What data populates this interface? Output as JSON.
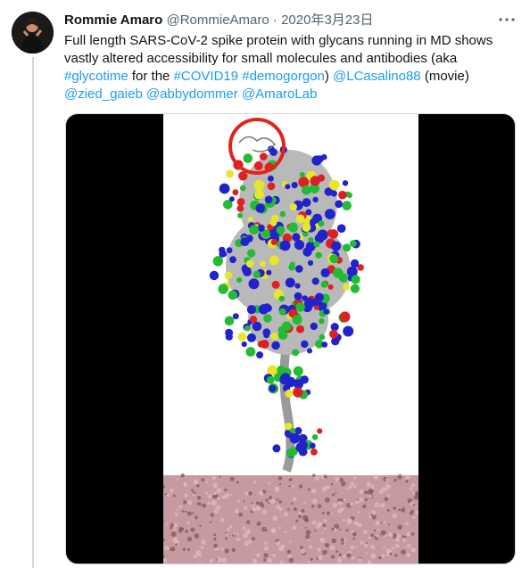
{
  "tweet": {
    "author_name": "Rommie Amaro",
    "handle": "@RommieAmaro",
    "separator": "·",
    "date": "2020年3月23日",
    "more_icon": "ellipsis-icon",
    "text_lines": [
      [
        {
          "t": "Full length SARS-CoV-2 spike protein with glycans running in MD shows",
          "link": false
        }
      ],
      [
        {
          "t": "vastly altered accessibility for small molecules and antibodies (aka",
          "link": false
        }
      ],
      [
        {
          "t": "#glycotime",
          "link": true
        },
        {
          "t": " for the ",
          "link": false
        },
        {
          "t": "#COVID19",
          "link": true
        },
        {
          "t": " ",
          "link": false
        },
        {
          "t": "#demogorgon",
          "link": true
        },
        {
          "t": ") ",
          "link": false
        },
        {
          "t": "@LCasalino88",
          "link": true
        },
        {
          "t": " (movie)",
          "link": false
        }
      ],
      [
        {
          "t": "@zied_gaieb",
          "link": true
        },
        {
          "t": " ",
          "link": false
        },
        {
          "t": "@abbydommer",
          "link": true
        },
        {
          "t": " ",
          "link": false
        },
        {
          "t": "@AmaroLab",
          "link": true
        }
      ]
    ]
  },
  "colors": {
    "link": "#1d9bf0",
    "glycan_blue": "#2222cc",
    "glycan_green": "#22bb33",
    "glycan_red": "#dd2020",
    "glycan_yellow": "#e6e62a",
    "membrane": "#c69aa0",
    "highlight_circle": "#e0261b"
  }
}
